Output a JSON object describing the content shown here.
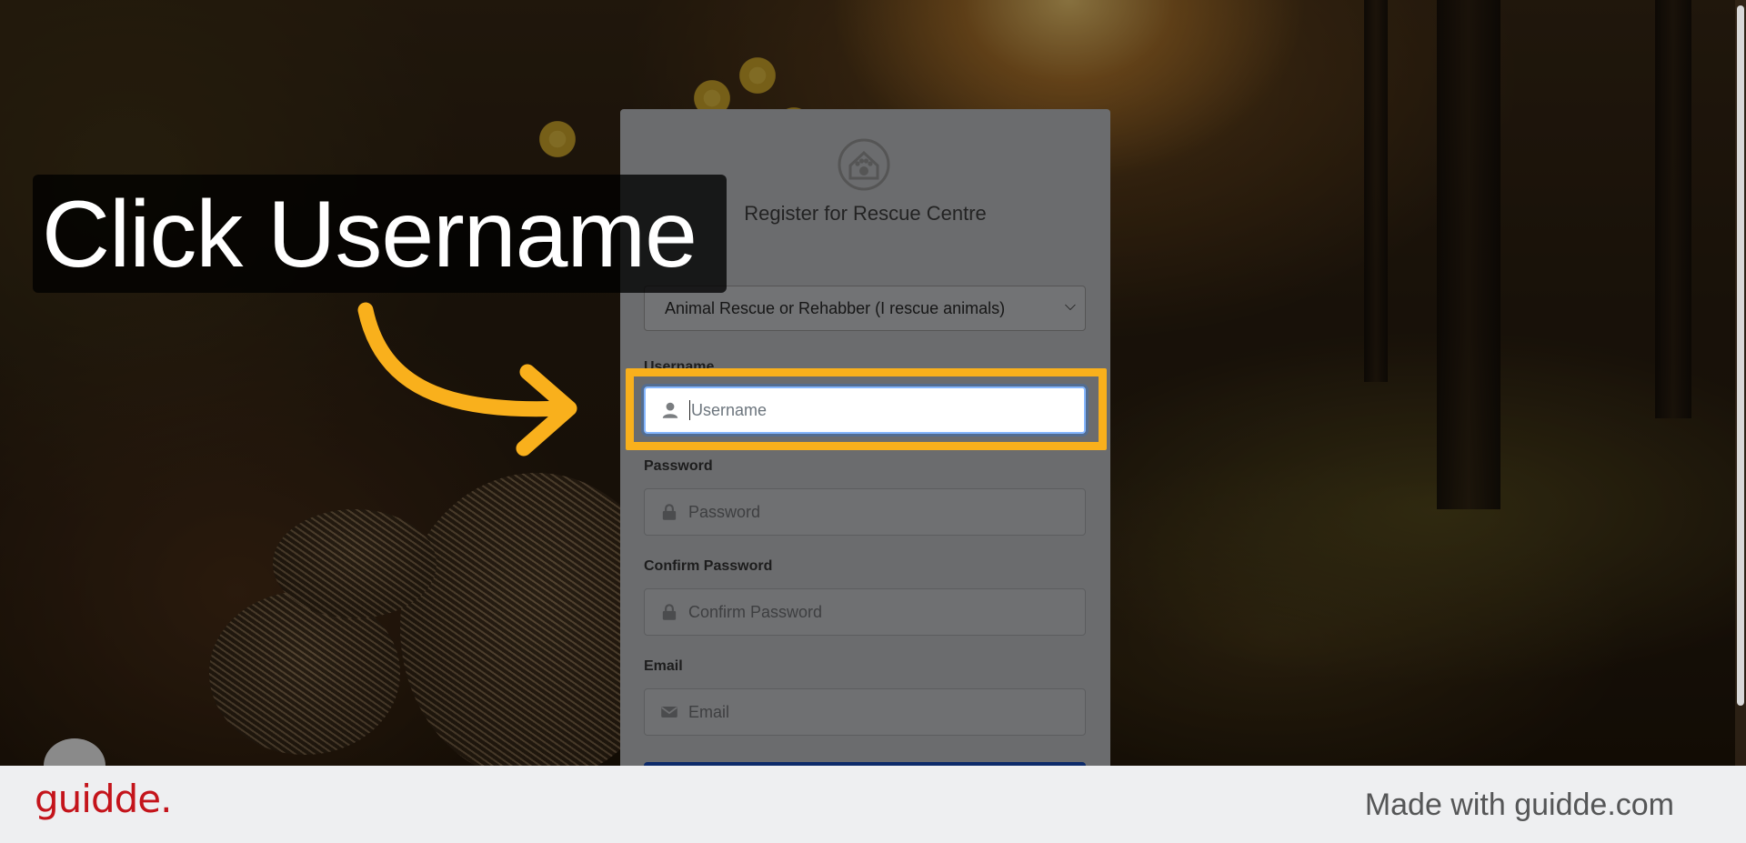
{
  "callout": {
    "text": "Click Username"
  },
  "form": {
    "title": "Register for Rescue Centre",
    "role_select": {
      "value": "Animal Rescue or Rehabber (I rescue animals)"
    },
    "username": {
      "label": "Username",
      "placeholder": "Username"
    },
    "password": {
      "label": "Password",
      "placeholder": "Password"
    },
    "confirm_password": {
      "label": "Confirm Password",
      "placeholder": "Confirm Password"
    },
    "email": {
      "label": "Email",
      "placeholder": "Email"
    }
  },
  "footer": {
    "brand": "guidde.",
    "made_with": "Made with guidde.com"
  },
  "colors": {
    "highlight": "#f9b01c",
    "brand": "#c4141b"
  },
  "icons": [
    "user-icon",
    "lock-icon",
    "envelope-icon",
    "paw-logo-icon",
    "arrow-icon",
    "chevron-down-icon"
  ]
}
